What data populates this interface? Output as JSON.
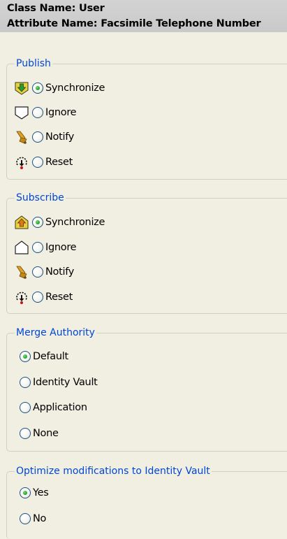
{
  "header": {
    "class_name": "Class Name: User",
    "attribute_name": "Attribute Name: Facsimile Telephone Number"
  },
  "publish": {
    "legend": "Publish",
    "options": [
      {
        "label": "Synchronize",
        "icon": "publish-synchronize-icon",
        "checked": true
      },
      {
        "label": "Ignore",
        "icon": "publish-ignore-icon",
        "checked": false
      },
      {
        "label": "Notify",
        "icon": "notify-bell-icon",
        "checked": false
      },
      {
        "label": "Reset",
        "icon": "reset-icon",
        "checked": false
      }
    ]
  },
  "subscribe": {
    "legend": "Subscribe",
    "options": [
      {
        "label": "Synchronize",
        "icon": "subscribe-synchronize-icon",
        "checked": true
      },
      {
        "label": "Ignore",
        "icon": "subscribe-ignore-icon",
        "checked": false
      },
      {
        "label": "Notify",
        "icon": "notify-bell-icon",
        "checked": false
      },
      {
        "label": "Reset",
        "icon": "reset-icon",
        "checked": false
      }
    ]
  },
  "merge_authority": {
    "legend": "Merge Authority",
    "options": [
      {
        "label": "Default",
        "checked": true
      },
      {
        "label": "Identity Vault",
        "checked": false
      },
      {
        "label": "Application",
        "checked": false
      },
      {
        "label": "None",
        "checked": false
      }
    ]
  },
  "optimize": {
    "legend": "Optimize modifications to Identity Vault",
    "options": [
      {
        "label": "Yes",
        "checked": true
      },
      {
        "label": "No",
        "checked": false
      }
    ]
  },
  "colors": {
    "legend": "#0046d5",
    "background": "#f1efe2",
    "header_bg": "#cfcfcf",
    "radio_check": "#21a121"
  }
}
